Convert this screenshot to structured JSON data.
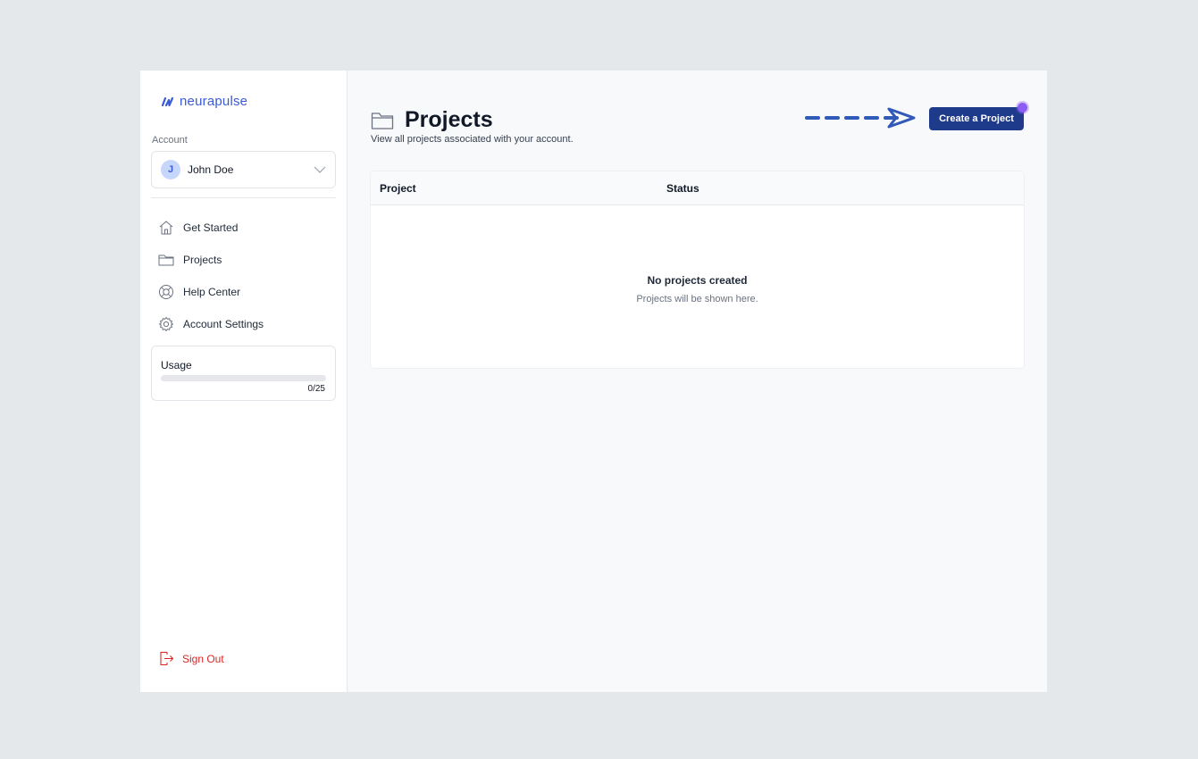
{
  "brand": {
    "name": "neurapulse",
    "color": "#3b5bd6"
  },
  "sidebar": {
    "account_label": "Account",
    "account": {
      "initial": "J",
      "name": "John Doe"
    },
    "items": [
      {
        "label": "Get Started",
        "icon": "home-icon"
      },
      {
        "label": "Projects",
        "icon": "folder-icon"
      },
      {
        "label": "Help Center",
        "icon": "lifebuoy-icon"
      },
      {
        "label": "Account Settings",
        "icon": "gear-icon"
      }
    ],
    "usage": {
      "title": "Usage",
      "count": "0/25",
      "fraction": 0
    },
    "sign_out": "Sign Out"
  },
  "main": {
    "title": "Projects",
    "subtitle": "View all projects associated with your account.",
    "create_button": "Create a Project",
    "table": {
      "columns": [
        "Project",
        "Status"
      ],
      "empty_title": "No projects created",
      "empty_subtitle": "Projects will be shown here."
    }
  },
  "colors": {
    "primary_button": "#1e3a8a",
    "danger": "#dc2626",
    "indicator": "#8b5cf6",
    "arrow": "#3059b8"
  }
}
